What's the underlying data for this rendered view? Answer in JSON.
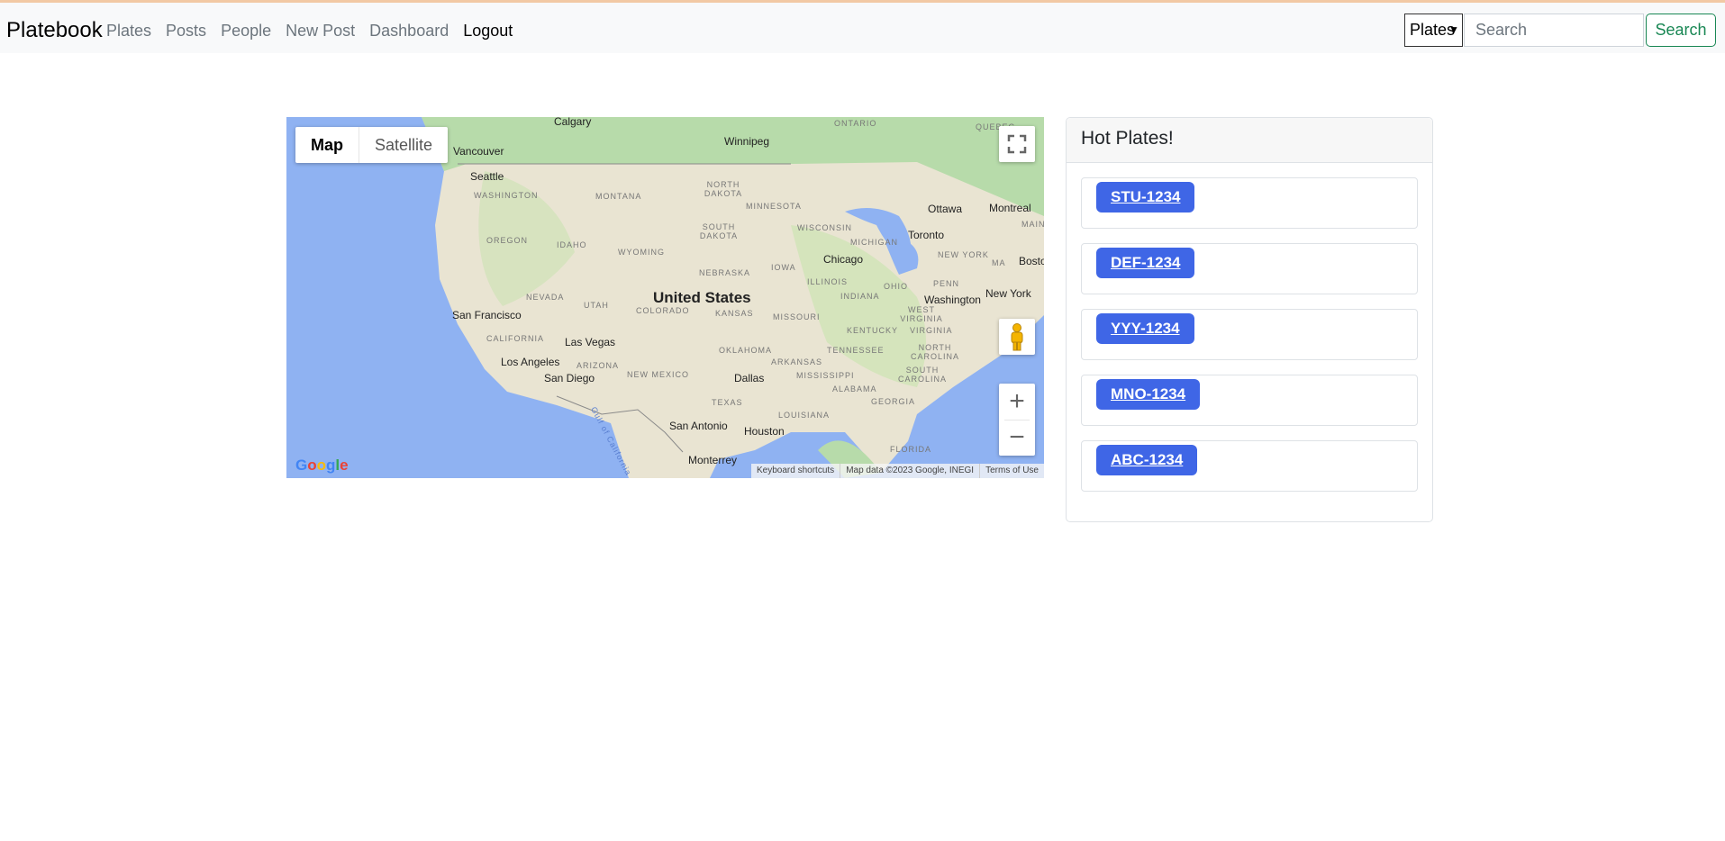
{
  "navbar": {
    "brand": "Platebook",
    "links": [
      "Plates",
      "Posts",
      "People",
      "New Post",
      "Dashboard",
      "Logout"
    ],
    "search_type_selected": "Plates",
    "search_placeholder": "Search",
    "search_button": "Search"
  },
  "map": {
    "type_map": "Map",
    "type_satellite": "Satellite",
    "zoom_in": "+",
    "zoom_out": "−",
    "logo": "Google",
    "attribution": [
      "Keyboard shortcuts",
      "Map data ©2023 Google, INEGI",
      "Terms of Use"
    ],
    "labels": {
      "country": "United States",
      "cities": [
        "Calgary",
        "Winnipeg",
        "Vancouver",
        "Seattle",
        "Ottawa",
        "Montreal",
        "Toronto",
        "Chicago",
        "Boston",
        "New York",
        "Washington",
        "San Francisco",
        "Las Vegas",
        "Los Angeles",
        "San Diego",
        "Dallas",
        "San Antonio",
        "Houston",
        "Monterrey"
      ],
      "states": [
        "ONTARIO",
        "QUEBEC",
        "WASHINGTON",
        "MONTANA",
        "NORTH DAKOTA",
        "MINNESOTA",
        "OREGON",
        "IDAHO",
        "WYOMING",
        "SOUTH DAKOTA",
        "WISCONSIN",
        "MICHIGAN",
        "NEBRASKA",
        "IOWA",
        "NEVADA",
        "UTAH",
        "COLORADO",
        "KANSAS",
        "ILLINOIS",
        "INDIANA",
        "OHIO",
        "PENN",
        "NEW YORK",
        "MAINE",
        "MA",
        "CALIFORNIA",
        "MISSOURI",
        "KENTUCKY",
        "WEST VIRGINIA",
        "VIRGINIA",
        "ARIZONA",
        "NEW MEXICO",
        "OKLAHOMA",
        "ARKANSAS",
        "TENNESSEE",
        "NORTH CAROLINA",
        "SOUTH CAROLINA",
        "MISSISSIPPI",
        "ALABAMA",
        "GEORGIA",
        "TEXAS",
        "LOUISIANA",
        "FLORIDA"
      ],
      "water": "Gulf of California"
    }
  },
  "hot_plates": {
    "title": "Hot Plates!",
    "items": [
      "STU-1234",
      "DEF-1234",
      "YYY-1234",
      "MNO-1234",
      "ABC-1234"
    ]
  }
}
